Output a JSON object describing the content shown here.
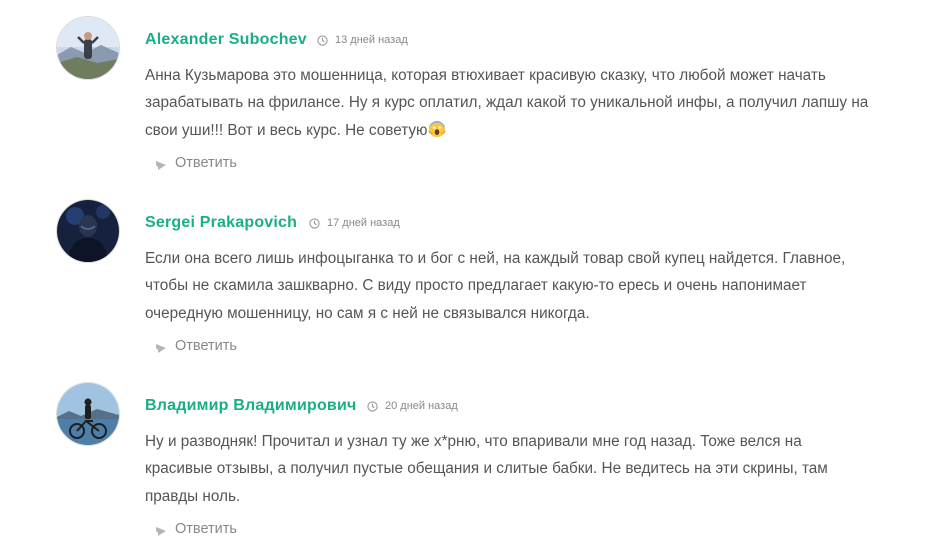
{
  "comments": [
    {
      "author": "Alexander Subochev",
      "date": "13 дней назад",
      "lines": [
        "Анна Кузьмарова это мошенница, которая втюхивает красивую сказку, что любой может начать",
        "зарабатывать на фрилансе. Ну я курс оплатил, ждал какой то уникальной инфы, а получил лапшу на",
        "свои уши!!! Вот и весь курс. Не советую"
      ],
      "reply": "Ответить"
    },
    {
      "author": "Sergei Prakapovich",
      "date": "17 дней назад",
      "lines": [
        "Если она всего лишь инфоцыганка то и бог с ней, на каждый товар свой купец найдется. Главное,",
        "чтобы не скамила зашкварно. С виду просто предлагает какую-то ересь и очень напонимает",
        "очередную мошенницу, но сам я с ней не связывался никогда."
      ],
      "reply": "Ответить"
    },
    {
      "author": "Владимир Владимирович",
      "date": "20 дней назад",
      "lines": [
        "Ну и разводняк! Прочитал и узнал ту же х*рню, что впаривали мне год назад. Тоже велся на",
        "красивые отзывы, а получил пустые обещания и слитые бабки. Не ведитесь на эти скрины, там",
        "правды ноль."
      ],
      "reply": "Ответить"
    }
  ],
  "icons": {
    "clock": "clock-icon",
    "reply": "reply-arrow-icon",
    "emoji": "scream-emoji-icon"
  },
  "colors": {
    "author": "#1aae86",
    "text": "#555555",
    "meta": "#888888",
    "reply_icon": "#b5b5b5"
  }
}
